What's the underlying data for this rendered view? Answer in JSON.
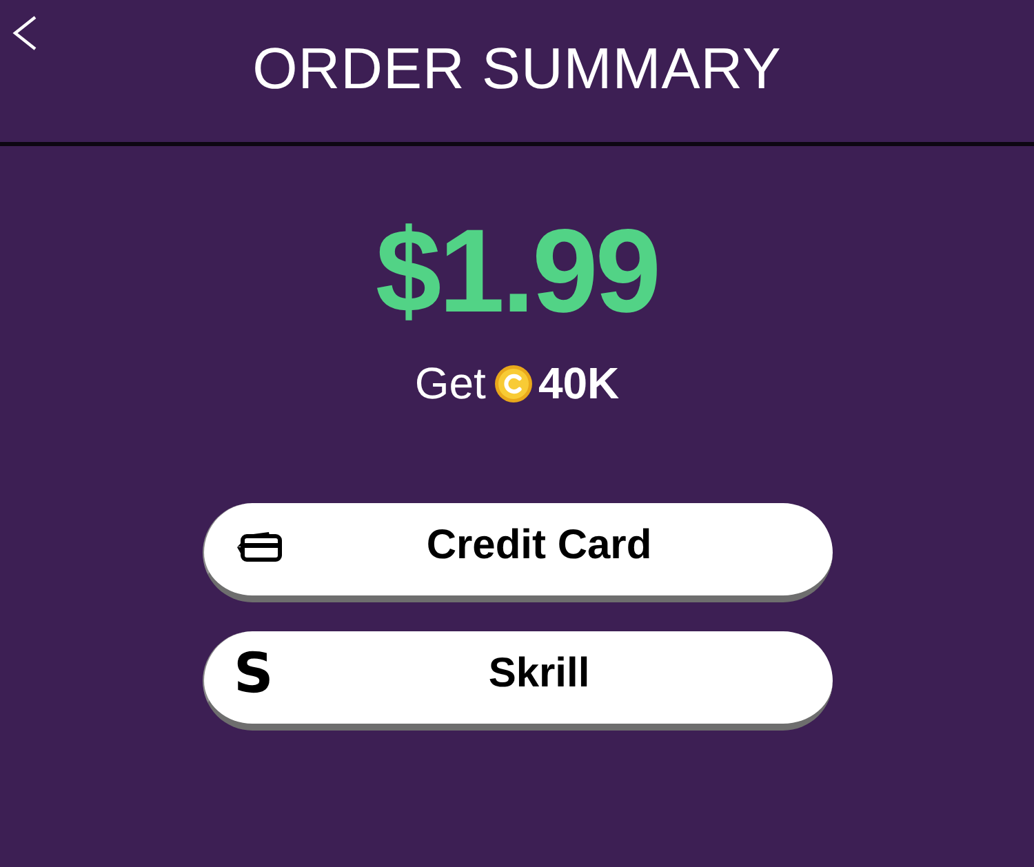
{
  "header": {
    "title": "ORDER SUMMARY"
  },
  "offer": {
    "price": "$1.99",
    "reward_prefix": "Get",
    "reward_amount": "40K"
  },
  "payment_methods": [
    {
      "kind": "card",
      "label": "Credit Card"
    },
    {
      "kind": "glyph",
      "glyph": "S",
      "label": "Skrill"
    }
  ]
}
